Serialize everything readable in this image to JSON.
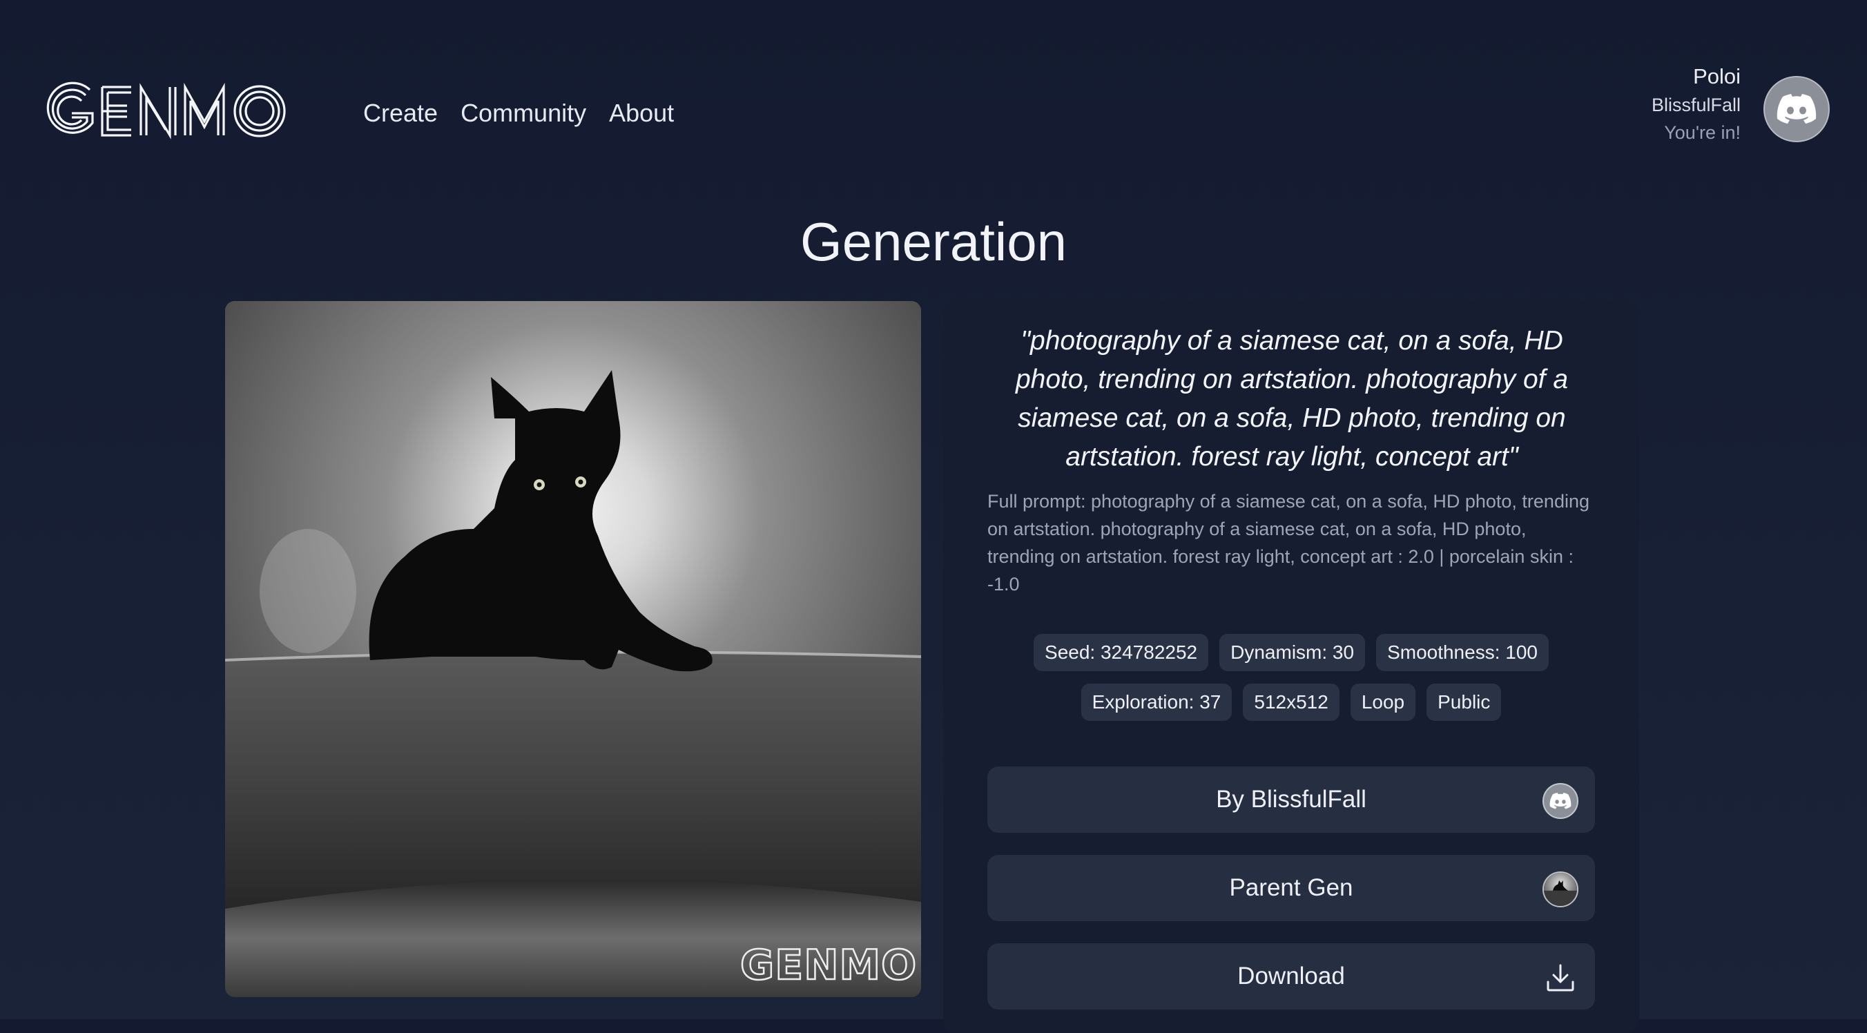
{
  "header": {
    "logo_text": "GENMO",
    "nav": [
      {
        "label": "Create"
      },
      {
        "label": "Community"
      },
      {
        "label": "About"
      }
    ],
    "user": {
      "name": "Poloi",
      "handle": "BlissfulFall",
      "status": "You're in!",
      "avatar_icon": "discord-icon"
    }
  },
  "page": {
    "title": "Generation"
  },
  "image": {
    "watermark": "GENMO"
  },
  "details": {
    "prompt_quote": "\"photography of a siamese cat, on a sofa, HD photo, trending on artstation. photography of a siamese cat, on a sofa, HD photo, trending on artstation. forest ray light, concept art\"",
    "full_prompt": "Full prompt: photography of a siamese cat, on a sofa, HD photo, trending on artstation. photography of a siamese cat, on a sofa, HD photo, trending on artstation. forest ray light, concept art : 2.0 | porcelain skin : -1.0",
    "chips": [
      "Seed: 324782252",
      "Dynamism: 30",
      "Smoothness: 100",
      "Exploration: 37",
      "512x512",
      "Loop",
      "Public"
    ],
    "actions": {
      "author_label": "By BlissfulFall",
      "parent_label": "Parent Gen",
      "download_label": "Download"
    }
  },
  "colors": {
    "background": "#161d31",
    "panel": "#161d30",
    "button": "#262e42",
    "chip": "#2a3246"
  }
}
